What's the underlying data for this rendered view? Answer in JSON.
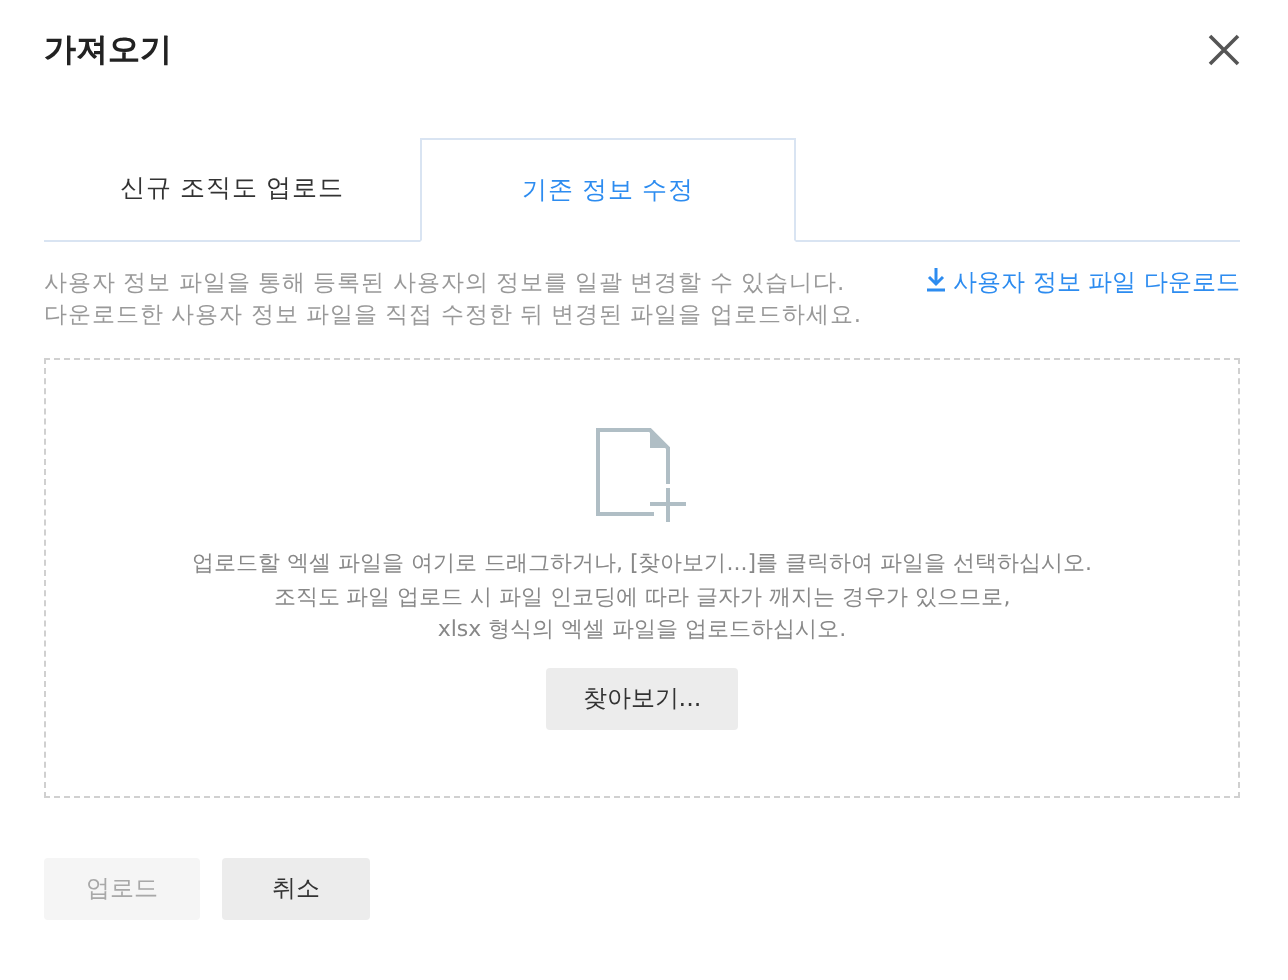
{
  "dialog": {
    "title": "가져오기"
  },
  "tabs": [
    {
      "label": "신규 조직도 업로드",
      "selected": false
    },
    {
      "label": "기존 정보 수정",
      "selected": true
    }
  ],
  "description": [
    "사용자 정보 파일을 통해 등록된 사용자의 정보를 일괄 변경할 수 있습니다.",
    "다운로드한 사용자 정보 파일을 직접 수정한 뒤 변경된 파일을 업로드하세요."
  ],
  "download_link": "사용자 정보 파일 다운로드",
  "dropzone": {
    "lines": [
      "업로드할 엑셀 파일을 여기로 드래그하거나, [찾아보기...]를 클릭하여 파일을 선택하십시오.",
      "조직도 파일 업로드 시 파일 인코딩에 따라 글자가 깨지는 경우가 있으므로,",
      "xlsx 형식의 엑셀 파일을 업로드하십시오."
    ],
    "browse_button": "찾아보기..."
  },
  "buttons": [
    {
      "label": "업로드",
      "disabled": true
    },
    {
      "label": "취소",
      "disabled": false
    }
  ]
}
